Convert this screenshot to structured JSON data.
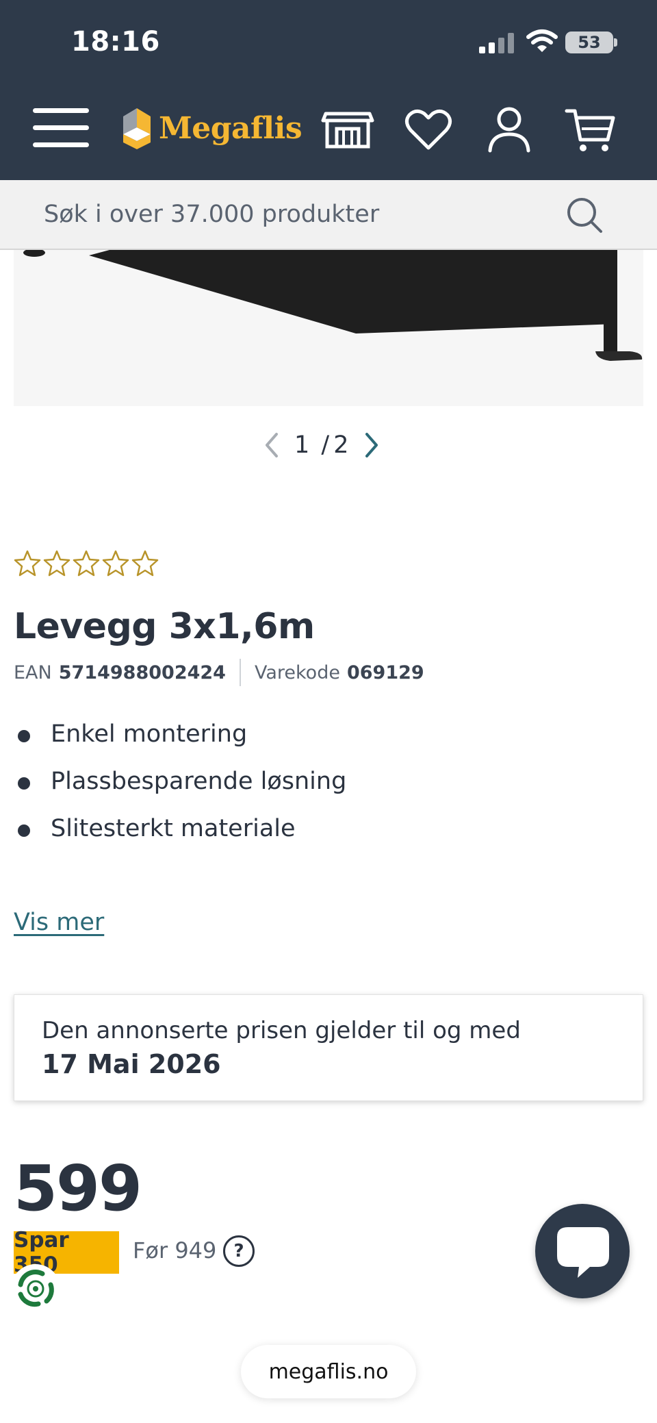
{
  "status_bar": {
    "time": "18:16",
    "battery": "53"
  },
  "header": {
    "brand": "Megaflis",
    "icons": [
      "menu-icon",
      "store-icon",
      "heart-icon",
      "user-icon",
      "cart-icon"
    ],
    "colors": {
      "background": "#2e3a4a",
      "brand": "#f5b733"
    }
  },
  "search": {
    "placeholder": "Søk i over 37.000 produkter"
  },
  "gallery": {
    "current": "1",
    "separator": "/",
    "total": "2"
  },
  "product": {
    "rating": 0,
    "rating_max": 5,
    "title": "Levegg 3x1,6m",
    "ean_label": "EAN",
    "ean": "5714988002424",
    "varekode_label": "Varekode",
    "varekode": "069129",
    "features": [
      "Enkel montering",
      "Plassbesparende løsning",
      "Slitesterkt materiale"
    ],
    "show_more": "Vis mer"
  },
  "price_notice": {
    "line1": "Den annonserte prisen gjelder til og med",
    "line2": "17 Mai 2026"
  },
  "pricing": {
    "price": "599",
    "save": "Spar 350",
    "before": "Før 949",
    "help": "?",
    "badge_color": "#f6b400"
  },
  "browser": {
    "url": "megaflis.no"
  }
}
